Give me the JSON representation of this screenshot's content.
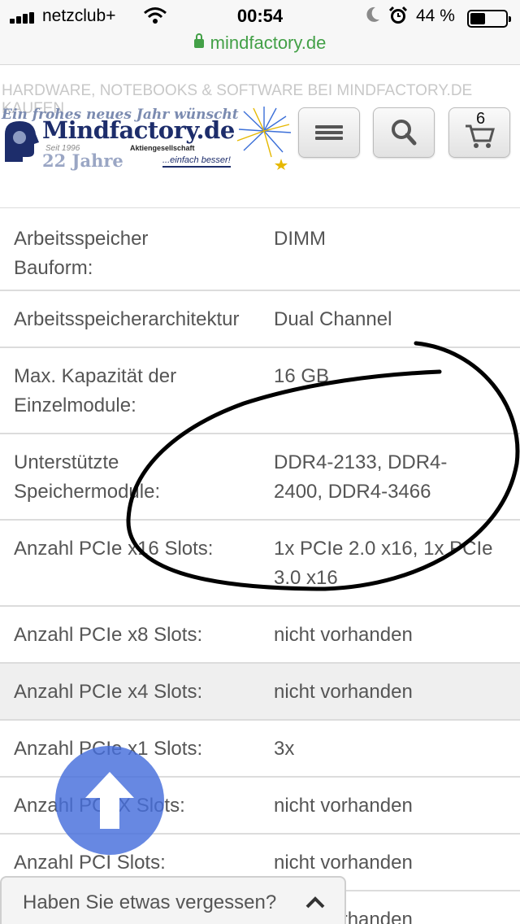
{
  "status_bar": {
    "carrier": "netzclub+",
    "time": "00:54",
    "battery_percent": "44 %",
    "battery_level": 0.44,
    "url": "mindfactory.de"
  },
  "header": {
    "site_title": "HARDWARE, NOTEBOOKS & SOFTWARE BEI MINDFACTORY.DE KAUFEN",
    "logo": {
      "banner": "Ein frohes neues Jahr wünscht",
      "name": "Mindfactory.de",
      "since": "Seit 1996",
      "years": "22 Jahre",
      "legal": "Aktiengesellschaft",
      "slogan": "...einfach besser!"
    },
    "menu_icon": "hamburger-icon",
    "search_icon": "search-icon",
    "cart_icon": "cart-icon",
    "cart_count": "6"
  },
  "specs": [
    {
      "label_lines": [
        "Arbeitsspeicher",
        "Bauform:"
      ],
      "value_lines": [
        "DIMM"
      ]
    },
    {
      "label_lines": [
        "Arbeitsspeicherarchitektur"
      ],
      "value_lines": [
        "Dual Channel"
      ]
    },
    {
      "label_lines": [
        "Max. Kapazität der",
        "Einzelmodule:"
      ],
      "value_lines": [
        "16 GB"
      ]
    },
    {
      "label_lines": [
        "Unterstützte",
        "Speichermodule:"
      ],
      "value_lines": [
        "DDR4-2133, DDR4-",
        "2400, DDR4-3466"
      ]
    },
    {
      "label_lines": [
        "Anzahl PCIe x16 Slots:"
      ],
      "value_lines": [
        "1x PCIe 2.0 x16, 1x PCIe",
        "3.0 x16"
      ]
    },
    {
      "label_lines": [
        "Anzahl PCIe x8 Slots:"
      ],
      "value_lines": [
        "nicht vorhanden"
      ]
    },
    {
      "label_lines": [
        "Anzahl PCIe x4 Slots:"
      ],
      "value_lines": [
        "nicht vorhanden"
      ]
    },
    {
      "label_lines": [
        "Anzahl PCIe x1 Slots:"
      ],
      "value_lines": [
        "3x"
      ]
    },
    {
      "label_lines": [
        "Anzahl PCI-X Slots:"
      ],
      "value_lines": [
        "nicht vorhanden"
      ]
    },
    {
      "label_lines": [
        "Anzahl PCI Slots:"
      ],
      "value_lines": [
        "nicht vorhanden"
      ]
    },
    {
      "label_lines": [
        ""
      ],
      "value_lines": [
        "nicht vorhanden"
      ]
    }
  ],
  "scroll_top_icon": "arrow-up-icon",
  "reminder": {
    "text": "Haben Sie etwas vergessen?",
    "icon": "chevron-up-icon"
  },
  "colors": {
    "url_green": "#43a047",
    "brand_navy": "#1d2d6b",
    "scroll_button": "#466edc",
    "alt_row": "#efefef"
  }
}
